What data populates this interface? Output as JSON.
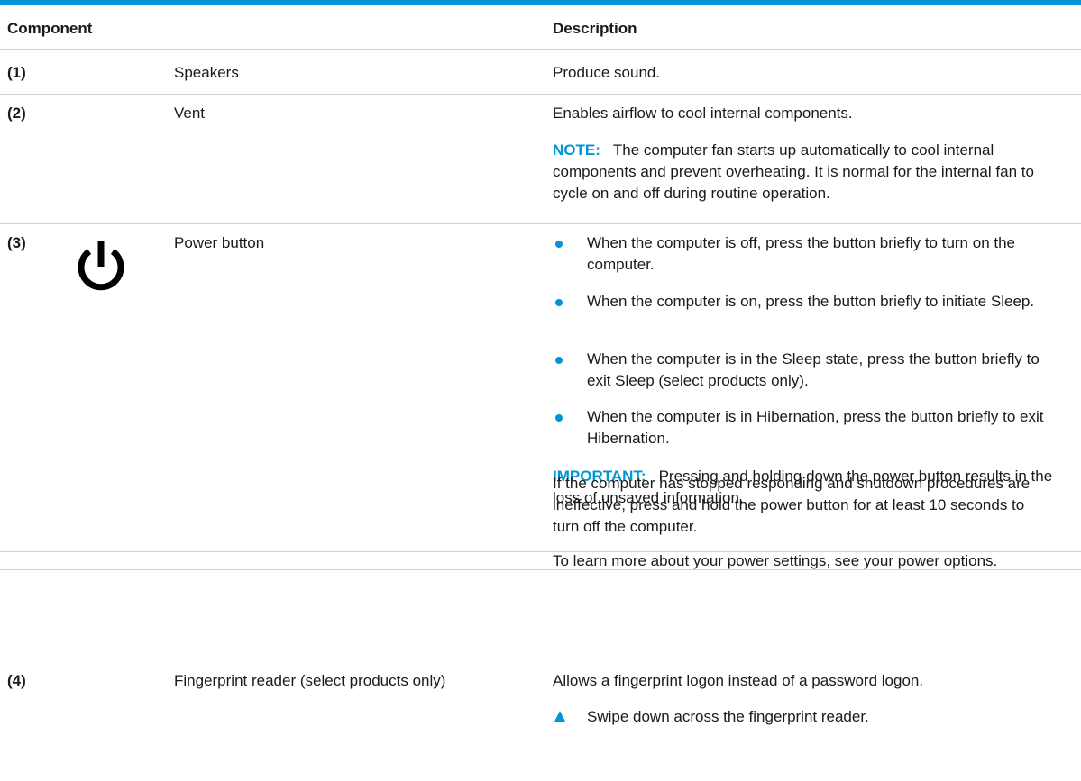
{
  "header": {
    "component": "Component",
    "description": "Description"
  },
  "rows": [
    {
      "num": "(1)",
      "name": "Speakers",
      "description": "Produce sound."
    },
    {
      "num": "(2)",
      "name": "Vent",
      "description": "Enables airflow to cool internal components.",
      "note_label": "NOTE:",
      "note_text": "The computer fan starts up automatically to cool internal components and prevent overheating. It is normal for the internal fan to cycle on and off during routine operation."
    },
    {
      "num": "(3)",
      "icon": "power-icon",
      "name": "Power button",
      "bullets": [
        "When the computer is off, press the button briefly to turn on the computer.",
        "When the computer is on, press the button briefly to initiate Sleep.",
        "When the computer is in the Sleep state, press the button briefly to exit Sleep (select products only).",
        "When the computer is in Hibernation, press the button briefly to exit Hibernation."
      ],
      "important_label": "IMPORTANT:",
      "important_text": "Pressing and holding down the power button results in the loss of unsaved information.",
      "para1": "If the computer has stopped responding and shutdown procedures are ineffective, press and hold the power button for at least 10 seconds to turn off the computer.",
      "para2": "To learn more about your power settings, see your power options."
    },
    {
      "num": "(4)",
      "name": "Fingerprint reader (select products only)",
      "description": "Allows a fingerprint logon instead of a password logon.",
      "step": "Swipe down across the fingerprint reader."
    }
  ],
  "colors": {
    "accent": "#0096d6",
    "rule": "#d0d0d0",
    "text": "#1a1a1a"
  }
}
